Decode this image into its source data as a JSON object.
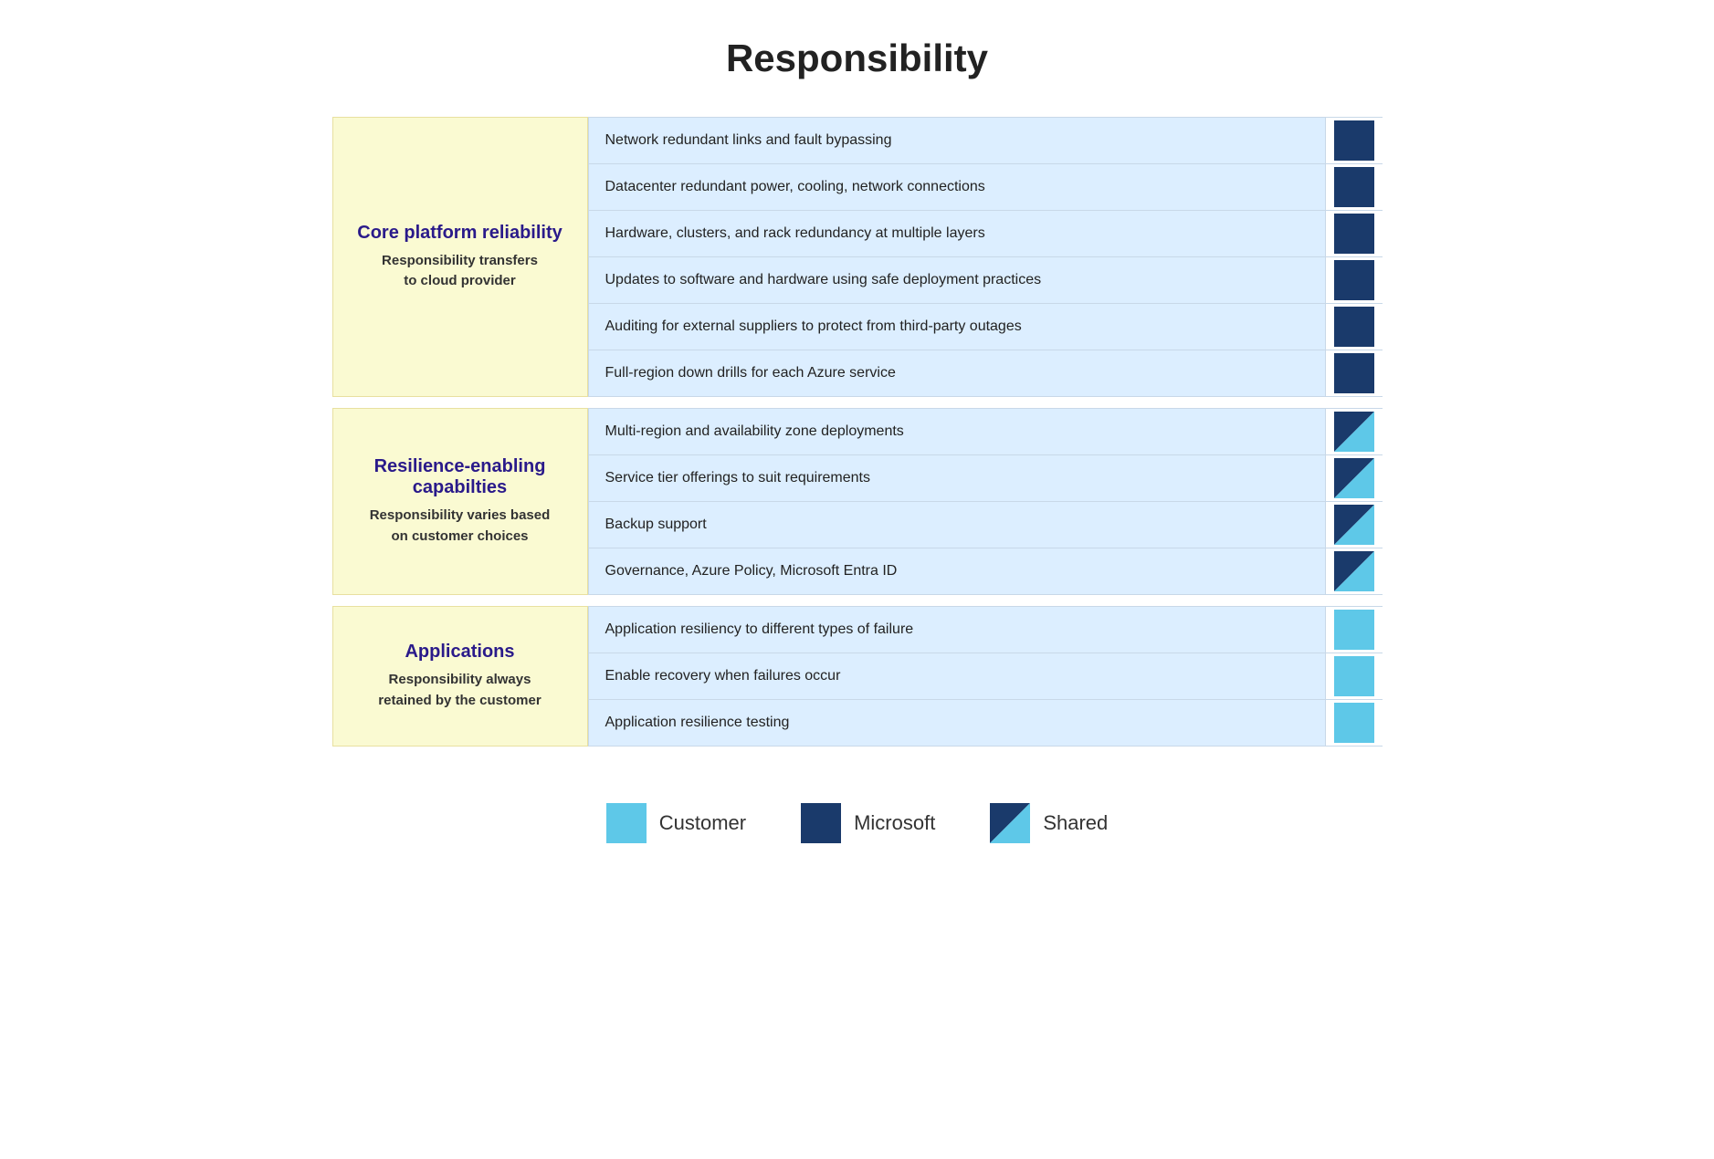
{
  "title": "Responsibility",
  "sections": [
    {
      "id": "core-platform",
      "title": "Core platform reliability",
      "subtitle": "Responsibility transfers\nto cloud provider",
      "rows": [
        {
          "text": "Network redundant links and fault bypassing",
          "icon": "microsoft"
        },
        {
          "text": "Datacenter redundant power, cooling, network connections",
          "icon": "microsoft"
        },
        {
          "text": "Hardware, clusters, and rack redundancy at multiple layers",
          "icon": "microsoft"
        },
        {
          "text": "Updates to software and hardware using safe deployment practices",
          "icon": "microsoft"
        },
        {
          "text": "Auditing for external suppliers to protect from third-party outages",
          "icon": "microsoft"
        },
        {
          "text": "Full-region down drills for each Azure service",
          "icon": "microsoft"
        }
      ]
    },
    {
      "id": "resilience-enabling",
      "title": "Resilience-enabling capabilties",
      "subtitle": "Responsibility varies based\non customer choices",
      "rows": [
        {
          "text": "Multi-region and availability zone deployments",
          "icon": "shared"
        },
        {
          "text": "Service tier offerings to suit requirements",
          "icon": "shared"
        },
        {
          "text": "Backup support",
          "icon": "shared"
        },
        {
          "text": "Governance, Azure Policy, Microsoft Entra ID",
          "icon": "shared"
        }
      ]
    },
    {
      "id": "applications",
      "title": "Applications",
      "subtitle": "Responsibility always\nretained by the customer",
      "rows": [
        {
          "text": "Application resiliency to different types of failure",
          "icon": "customer"
        },
        {
          "text": "Enable recovery when failures occur",
          "icon": "customer"
        },
        {
          "text": "Application resilience testing",
          "icon": "customer"
        }
      ]
    }
  ],
  "legend": {
    "items": [
      {
        "id": "customer",
        "label": "Customer",
        "icon": "customer"
      },
      {
        "id": "microsoft",
        "label": "Microsoft",
        "icon": "microsoft"
      },
      {
        "id": "shared",
        "label": "Shared",
        "icon": "shared"
      }
    ]
  }
}
